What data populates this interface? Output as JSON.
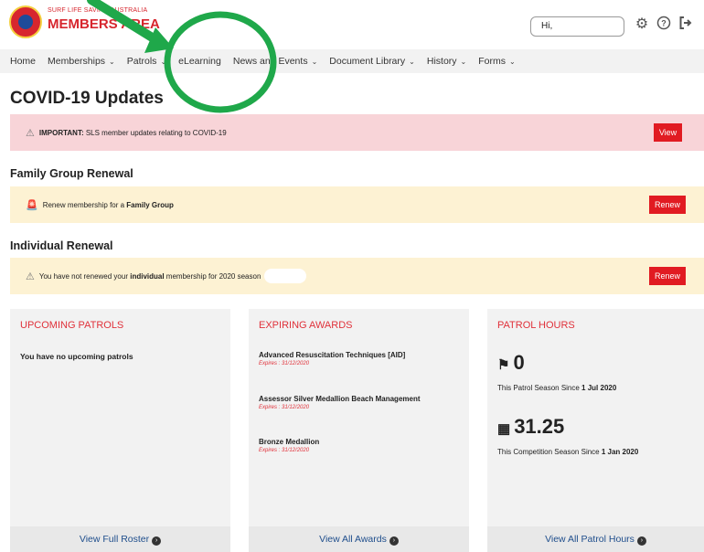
{
  "header": {
    "org_name": "SURF LIFE SAVING AUSTRALIA",
    "app_title": "MEMBERS AREA",
    "greeting": "Hi,",
    "icons": [
      "gear-icon",
      "help-icon",
      "logout-icon"
    ]
  },
  "nav": {
    "items": [
      {
        "label": "Home",
        "dropdown": false
      },
      {
        "label": "Memberships",
        "dropdown": true
      },
      {
        "label": "Patrols",
        "dropdown": true
      },
      {
        "label": "eLearning",
        "dropdown": false
      },
      {
        "label": "News and Events",
        "dropdown": true
      },
      {
        "label": "Document Library",
        "dropdown": true
      },
      {
        "label": "History",
        "dropdown": true
      },
      {
        "label": "Forms",
        "dropdown": true
      }
    ]
  },
  "covid": {
    "title": "COVID-19 Updates",
    "alert_strong": "IMPORTANT:",
    "alert_text": " SLS member updates relating to COVID-19",
    "button": "View"
  },
  "family": {
    "title": "Family Group Renewal",
    "text_before": "Renew membership for a ",
    "text_strong": "Family Group",
    "button": "Renew"
  },
  "individual": {
    "title": "Individual Renewal",
    "text_before": "You have not renewed your ",
    "text_strong": "individual",
    "text_after": " membership for 2020 season",
    "button": "Renew"
  },
  "patrols": {
    "title": "UPCOMING PATROLS",
    "empty_text": "You have no upcoming patrols",
    "footer": "View Full Roster"
  },
  "awards": {
    "title": "EXPIRING AWARDS",
    "items": [
      {
        "name": "Advanced Resuscitation Techniques [AID]",
        "expires": "Expires : 31/12/2020"
      },
      {
        "name": "Assessor Silver Medallion Beach Management",
        "expires": "Expires : 31/12/2020"
      },
      {
        "name": "Bronze Medallion",
        "expires": "Expires : 31/12/2020"
      }
    ],
    "footer": "View All Awards"
  },
  "hours": {
    "title": "PATROL HOURS",
    "patrol_value": "0",
    "patrol_text": "This Patrol Season Since ",
    "patrol_date": "1 Jul 2020",
    "comp_value": "31.25",
    "comp_text": "This Competition Season Since ",
    "comp_date": "1 Jan 2020",
    "footer": "View All Patrol Hours"
  },
  "colors": {
    "brand_red": "#e11b22",
    "link_blue": "#1f4e8c",
    "annotation_green": "#1fa84a"
  }
}
